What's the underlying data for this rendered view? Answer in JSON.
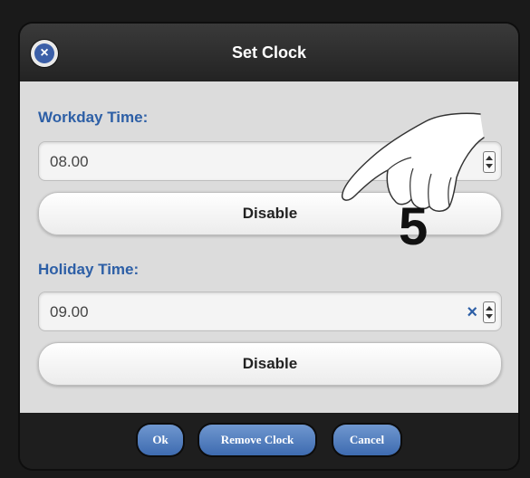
{
  "dialog": {
    "title": "Set Clock",
    "close_icon": "close-icon"
  },
  "workday": {
    "label": "Workday Time:",
    "value": "08.00",
    "button_label": "Disable"
  },
  "holiday": {
    "label": "Holiday Time:",
    "value": "09.00",
    "clear_label": "×",
    "button_label": "Disable"
  },
  "footer": {
    "ok_label": "Ok",
    "remove_label": "Remove Clock",
    "cancel_label": "Cancel"
  },
  "annotation": {
    "step_number": "5",
    "pointer_icon": "pointing-hand-icon"
  },
  "colors": {
    "accent": "#2d5fa6",
    "button_blue": "#4f7cbf",
    "panel_bg": "#dcdcdc",
    "header_bg": "#202020"
  }
}
